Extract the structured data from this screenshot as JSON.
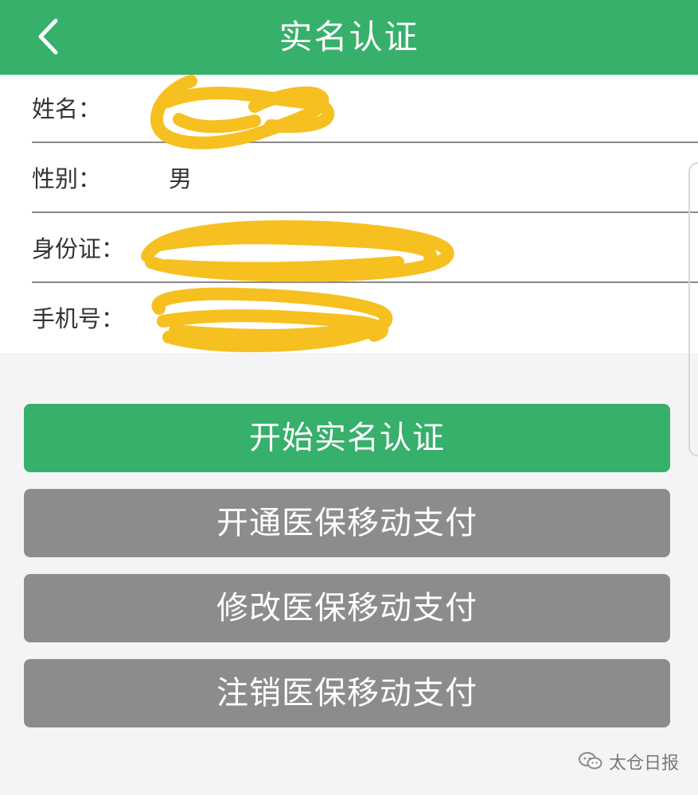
{
  "header": {
    "title": "实名认证",
    "back_icon": "chevron-left-icon",
    "background": "#36b06b"
  },
  "form": {
    "rows": [
      {
        "label": "姓名：",
        "value": ""
      },
      {
        "label": "性别：",
        "value": "男"
      },
      {
        "label": "身份证：",
        "value": ""
      },
      {
        "label": "手机号：",
        "value": ""
      }
    ]
  },
  "actions": {
    "start_verify": "开始实名认证",
    "open_payment": "开通医保移动支付",
    "modify_payment": "修改医保移动支付",
    "cancel_payment": "注销医保移动支付"
  },
  "colors": {
    "accent_green": "#36b06b",
    "button_gray": "#8c8c8c",
    "redaction_yellow": "#f6c021"
  },
  "watermark": {
    "text": "太仓日报",
    "icon": "wechat-icon"
  }
}
